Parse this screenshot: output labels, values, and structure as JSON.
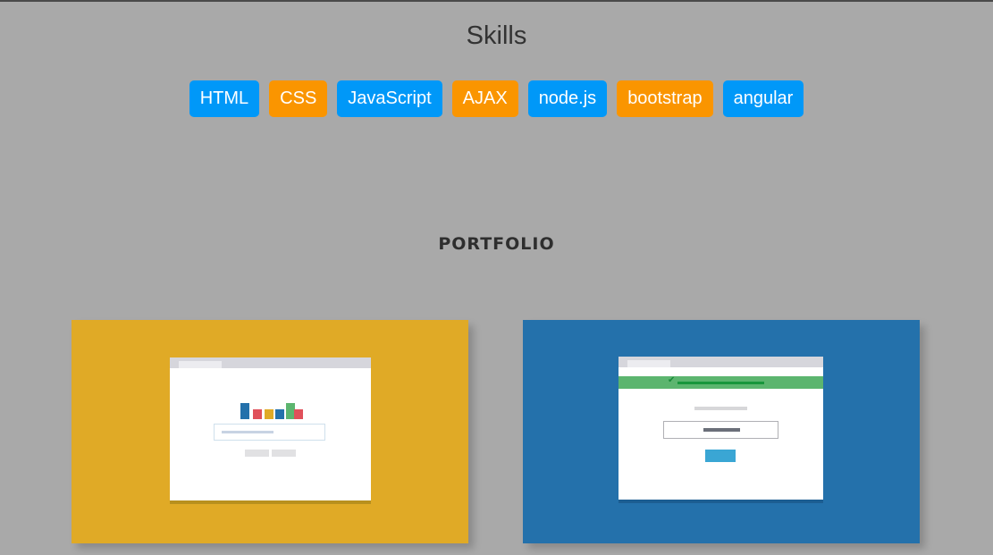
{
  "skills": {
    "title": "Skills",
    "tags": [
      {
        "label": "HTML",
        "color": "#0098f8"
      },
      {
        "label": "CSS",
        "color": "#fa9500"
      },
      {
        "label": "JavaScript",
        "color": "#0098f8"
      },
      {
        "label": "AJAX",
        "color": "#fa9500"
      },
      {
        "label": "node.js",
        "color": "#0098f8"
      },
      {
        "label": "bootstrap",
        "color": "#fa9500"
      },
      {
        "label": "angular",
        "color": "#0098f8"
      }
    ]
  },
  "portfolio": {
    "title": "PORTFOLIO",
    "cards": [
      {
        "background": "#e0aa26",
        "illustration": "analytics-search-mockup"
      },
      {
        "background": "#2471ab",
        "illustration": "signup-success-mockup"
      }
    ]
  },
  "colors": {
    "page_background": "#a9a9a9",
    "accent_blue": "#0098f8",
    "accent_orange": "#fa9500"
  }
}
